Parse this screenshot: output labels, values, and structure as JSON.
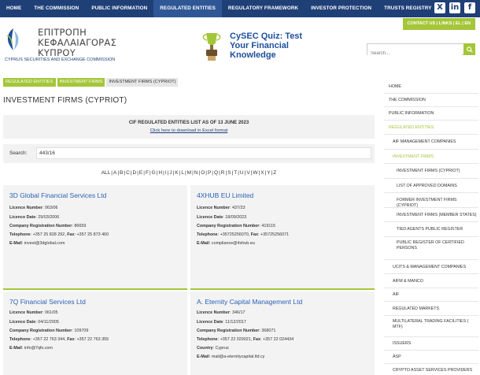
{
  "topnav": {
    "items": [
      "HOME",
      "THE COMMISSION",
      "PUBLIC INFORMATION",
      "REGULATED ENTITIES",
      "REGULATORY FRAMEWORK",
      "INVESTOR PROTECTION",
      "TRUSTS REGISTRY"
    ],
    "social": [
      "X",
      "in",
      "f"
    ]
  },
  "contact": "CONTACT US  |  LINKS  |  EL | EN",
  "logo": {
    "line1": "ΕΠΙΤΡΟΠΗ",
    "line2": "ΚΕΦΑΛΑΙΑΓΟΡΑΣ",
    "line3": "ΚΥΠΡΟΥ",
    "sub": "CYPRUS SECURITIES AND EXCHANGE COMMISSION"
  },
  "quiz": {
    "line1": "CySEC Quiz: Test",
    "line2": "Your Financial",
    "line3": "Knowledge"
  },
  "search": {
    "placeholder": "Search..."
  },
  "breadcrumb": [
    "REGULATED ENTITIES",
    "INVESTMENT FIRMS",
    "INVESTMENT FIRMS (CYPRIOT)"
  ],
  "page_title": "INVESTMENT FIRMS (CYPRIOT)",
  "list_head": {
    "title": "CIF REGULATED ENTITIES LIST AS OF 13 JUNE 2023",
    "download": "Click here to download in Excel format"
  },
  "filter": {
    "label": "Search:",
    "value": "443/16"
  },
  "alphabet": [
    "ALL",
    "A",
    "B",
    "C",
    "D",
    "E",
    "F",
    "G",
    "H",
    "I",
    "J",
    "K",
    "L",
    "M",
    "N",
    "O",
    "P",
    "Q",
    "R",
    "S",
    "T",
    "U",
    "V",
    "W",
    "X",
    "Y",
    "Z"
  ],
  "labels": {
    "licence_number": "Licence Number",
    "licence_date": "Licence Date",
    "company_reg": "Company Registration Number",
    "telephone": "Telephone",
    "fax": "Fax",
    "email": "E-Mail",
    "country": "Country"
  },
  "firms": [
    {
      "name": "3D Global Financial Services Ltd",
      "licence_number": "063/06",
      "licence_date": "29/03/2006",
      "company_reg": "86659",
      "telephone": "+357 25 828 292",
      "fax": "+357 25 873 460",
      "email": "invest@3dglobal.com"
    },
    {
      "name": "4XHUB EU Limited",
      "licence_number": "437/23",
      "licence_date": "18/09/2023",
      "company_reg": "419115",
      "telephone": "+35725256070",
      "fax": "+35725256071",
      "email": "compliance@4xhub.eu"
    },
    {
      "name": "7Q Financial Services Ltd",
      "licence_number": "061/05",
      "licence_date": "04/11/2005",
      "company_reg": "109709",
      "telephone": "+357 22 763 344",
      "fax": "+357 22 763 355",
      "email": "info@7qfs.com"
    },
    {
      "name": "A. Eternity Capital Management Ltd",
      "licence_number": "346/17",
      "licence_date": "11/12/2017",
      "company_reg": "368071",
      "telephone": "+357 22 029021",
      "fax": "+357 22 024434",
      "country": "Cyprus",
      "email": "mail@a-eternitycapital.ltd.cy"
    }
  ],
  "sidebar": [
    {
      "label": "HOME",
      "level": 1,
      "style": ""
    },
    {
      "label": "THE COMMISSION",
      "level": 1,
      "style": ""
    },
    {
      "label": "PUBLIC INFORMATION",
      "level": 1,
      "style": ""
    },
    {
      "label": "REGULATED ENTITIES",
      "level": 1,
      "style": "green"
    },
    {
      "label": "AIF MANAGEMENT COMPANIES",
      "level": 2,
      "style": ""
    },
    {
      "label": "INVESTMENT FIRMS",
      "level": 2,
      "style": "green"
    },
    {
      "label": "INVESTMENT FIRMS (CYPRIOT)",
      "level": 3,
      "style": ""
    },
    {
      "label": "LIST OF APPROVED DOMAINS",
      "level": 3,
      "style": ""
    },
    {
      "label": "FORMER INVESTMENT FIRMS (CYPRIOT)",
      "level": 3,
      "style": ""
    },
    {
      "label": "INVESTMENT FIRMS (MEMBER STATES)",
      "level": 3,
      "style": ""
    },
    {
      "label": "TIED AGENTS PUBLIC REGISTER",
      "level": 3,
      "style": ""
    },
    {
      "label": "PUBLIC REGISTER OF CERTIFIED PERSONS",
      "level": 3,
      "style": ""
    },
    {
      "label": "UCITS & MANAGEMENT COMPANIES",
      "level": 2,
      "style": ""
    },
    {
      "label": "AIFM & MANCO",
      "level": 2,
      "style": ""
    },
    {
      "label": "AIF",
      "level": 2,
      "style": ""
    },
    {
      "label": "REGULATED MARKETS",
      "level": 2,
      "style": ""
    },
    {
      "label": "MULTILATERAL TRADING FACILITIES ( MTF)",
      "level": 2,
      "style": ""
    },
    {
      "label": "ISSUERS",
      "level": 2,
      "style": ""
    },
    {
      "label": "ASP",
      "level": 2,
      "style": ""
    },
    {
      "label": "CRYPTO ASSET SERVICES PROVIDERS",
      "level": 2,
      "style": ""
    }
  ],
  "colors": {
    "nav": "#1f3f77",
    "accent": "#a4c639",
    "link": "#2a62b5"
  }
}
